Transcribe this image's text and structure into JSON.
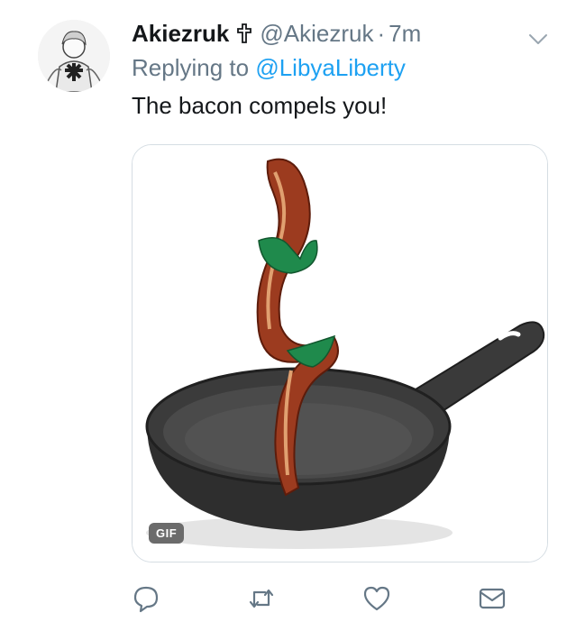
{
  "tweet": {
    "display_name": "Akiezruk",
    "badge_icon": "cross-icon",
    "handle": "@Akiezruk",
    "separator": "·",
    "time": "7m",
    "reply_prefix": "Replying to ",
    "reply_handle": "@LibyaLiberty",
    "text": "The bacon compels you!",
    "media": {
      "badge": "GIF"
    },
    "actions": [
      "reply-icon",
      "retweet-icon",
      "like-icon",
      "dm-icon"
    ]
  },
  "colors": {
    "text": "#14171a",
    "muted": "#657786",
    "link": "#1da1f2",
    "border": "#d5dde3"
  }
}
